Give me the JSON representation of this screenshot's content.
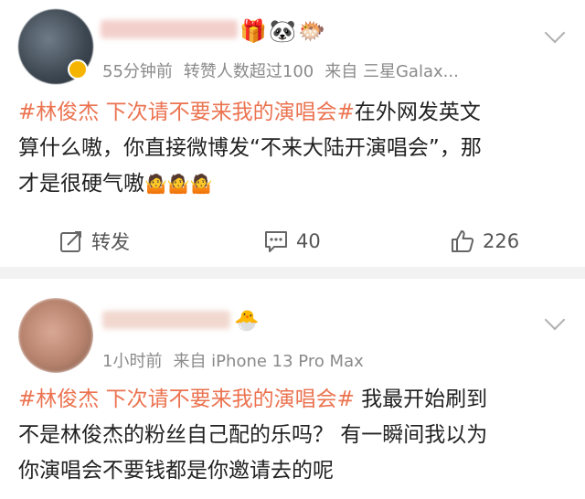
{
  "post1": {
    "meta": {
      "time": "55分钟前",
      "stat": "转赞人数超过100",
      "source": "来自 三星Galax..."
    },
    "emojis": [
      "🎁",
      "🐼",
      "🐡"
    ],
    "content": {
      "line1_topic": "#林俊杰 下次请不要来我的演唱会#",
      "line1_rest": "在外网发英文",
      "line2": "算什么嗷，你直接微博发“不来大陆开演唱会”，那",
      "line3_text": "才是很硬气嗷",
      "line3_emoji": "🤷🤷🤷"
    },
    "actions": {
      "repost_label": "转发",
      "comment_count": "40",
      "like_count": "226"
    }
  },
  "post2": {
    "meta": {
      "time": "1小时前",
      "source": "来自 iPhone 13 Pro Max"
    },
    "emojis": [
      "🐣"
    ],
    "content": {
      "line1_topic": "#林俊杰 下次请不要来我的演唱会#",
      "line1_rest": " 我最开始刷到",
      "line2": "不是林俊杰的粉丝自己配的乐吗？ 有一瞬间我以为",
      "line3": "你演唱会不要钱都是你邀请去的呢"
    }
  },
  "icons": {
    "repost": "edit-share-icon",
    "comment": "comment-icon",
    "like": "thumbs-up-icon",
    "more": "chevron-down-icon"
  },
  "colors": {
    "topic": "#eb7350",
    "meta": "#8a8a8a",
    "separator": "#f2f2f2"
  }
}
